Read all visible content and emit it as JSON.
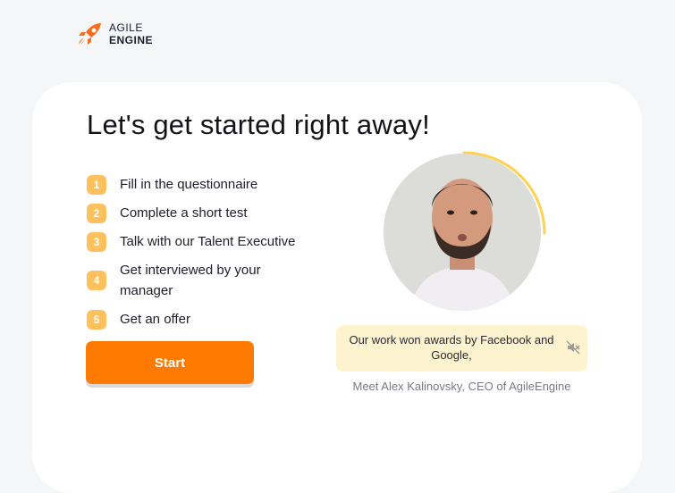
{
  "logo": {
    "line1": "AGILE",
    "line2": "ENGINE",
    "icon": "rocket-icon",
    "accent": "#ff6b1a"
  },
  "heading": "Let's get started right away!",
  "steps": [
    {
      "num": "1",
      "text": "Fill in the questionnaire"
    },
    {
      "num": "2",
      "text": "Complete a short test"
    },
    {
      "num": "3",
      "text": "Talk with our Talent Executive"
    },
    {
      "num": "4",
      "text": "Get interviewed by your manager"
    },
    {
      "num": "5",
      "text": "Get an offer"
    }
  ],
  "start_button": {
    "label": "Start",
    "color": "#ff7a00"
  },
  "video": {
    "caption": "Our work won awards by Facebook and Google,",
    "mute_icon": "muted-speaker-icon",
    "ring_color": "#ffd24d",
    "caption_bg": "#fdf3cf"
  },
  "presenter": "Meet Alex Kalinovsky, CEO of AgileEngine",
  "colors": {
    "step_badge": "#ffc15e",
    "background": "#f5f6f8"
  }
}
